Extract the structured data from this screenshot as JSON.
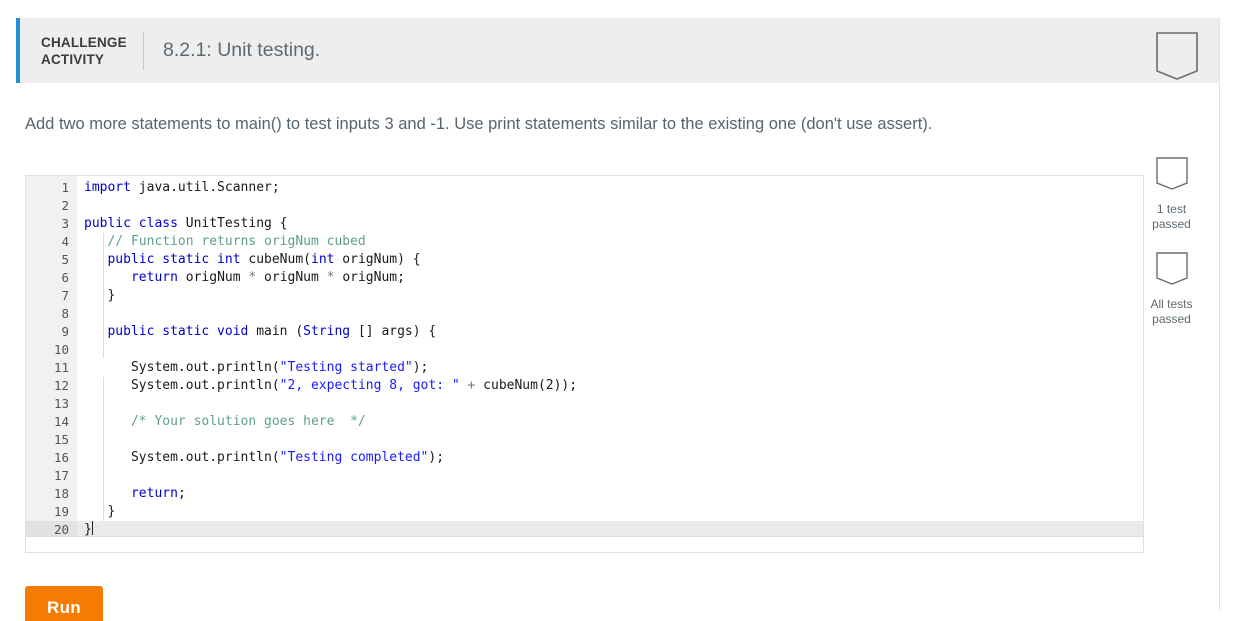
{
  "header": {
    "kicker_line1": "CHALLENGE",
    "kicker_line2": "ACTIVITY",
    "title": "8.2.1: Unit testing.",
    "bookmark_icon": "bookmark-outline-icon",
    "accent_color": "#1f8fd6",
    "background": "#eeeeee"
  },
  "prompt": {
    "text": "Add two more statements to main() to test inputs 3 and -1. Use print statements similar to the existing one (don't use assert)."
  },
  "editor": {
    "language": "java",
    "active_line": 20,
    "cursor_line": 20,
    "lines": [
      {
        "n": "1",
        "tokens": [
          {
            "t": "import",
            "c": "kw"
          },
          {
            "t": " java.util.Scanner;",
            "c": "pln"
          }
        ]
      },
      {
        "n": "2",
        "tokens": []
      },
      {
        "n": "3",
        "tokens": [
          {
            "t": "public class",
            "c": "kw"
          },
          {
            "t": " UnitTesting {",
            "c": "pln"
          }
        ]
      },
      {
        "n": "4",
        "tokens": [
          {
            "t": "   // Function returns origNum cubed",
            "c": "cmt"
          }
        ]
      },
      {
        "n": "5",
        "tokens": [
          {
            "t": "   ",
            "c": "pln"
          },
          {
            "t": "public static int",
            "c": "kw"
          },
          {
            "t": " cubeNum(",
            "c": "pln"
          },
          {
            "t": "int",
            "c": "kw"
          },
          {
            "t": " origNum) {",
            "c": "pln"
          }
        ]
      },
      {
        "n": "6",
        "tokens": [
          {
            "t": "      ",
            "c": "pln"
          },
          {
            "t": "return",
            "c": "kw"
          },
          {
            "t": " origNum ",
            "c": "pln"
          },
          {
            "t": "*",
            "c": "op"
          },
          {
            "t": " origNum ",
            "c": "pln"
          },
          {
            "t": "*",
            "c": "op"
          },
          {
            "t": " origNum;",
            "c": "pln"
          }
        ]
      },
      {
        "n": "7",
        "tokens": [
          {
            "t": "   }",
            "c": "pln"
          }
        ]
      },
      {
        "n": "8",
        "tokens": []
      },
      {
        "n": "9",
        "tokens": [
          {
            "t": "   ",
            "c": "pln"
          },
          {
            "t": "public static void",
            "c": "kw"
          },
          {
            "t": " main (",
            "c": "pln"
          },
          {
            "t": "String",
            "c": "kw"
          },
          {
            "t": " [] args) {",
            "c": "pln"
          }
        ]
      },
      {
        "n": "10",
        "tokens": []
      },
      {
        "n": "11",
        "tokens": [
          {
            "t": "      System.out.println(",
            "c": "pln"
          },
          {
            "t": "\"Testing started\"",
            "c": "str"
          },
          {
            "t": ");",
            "c": "pln"
          }
        ]
      },
      {
        "n": "12",
        "tokens": [
          {
            "t": "      System.out.println(",
            "c": "pln"
          },
          {
            "t": "\"2, expecting 8, got: \"",
            "c": "str"
          },
          {
            "t": " ",
            "c": "pln"
          },
          {
            "t": "+",
            "c": "op"
          },
          {
            "t": " cubeNum(2));",
            "c": "pln"
          }
        ]
      },
      {
        "n": "13",
        "tokens": []
      },
      {
        "n": "14",
        "tokens": [
          {
            "t": "      /* Your solution goes here  */",
            "c": "cmt"
          }
        ]
      },
      {
        "n": "15",
        "tokens": []
      },
      {
        "n": "16",
        "tokens": [
          {
            "t": "      System.out.println(",
            "c": "pln"
          },
          {
            "t": "\"Testing completed\"",
            "c": "str"
          },
          {
            "t": ");",
            "c": "pln"
          }
        ]
      },
      {
        "n": "17",
        "tokens": []
      },
      {
        "n": "18",
        "tokens": [
          {
            "t": "      ",
            "c": "pln"
          },
          {
            "t": "return",
            "c": "kw"
          },
          {
            "t": ";",
            "c": "pln"
          }
        ]
      },
      {
        "n": "19",
        "tokens": [
          {
            "t": "   }",
            "c": "pln"
          }
        ]
      },
      {
        "n": "20",
        "tokens": [
          {
            "t": "}",
            "c": "pln"
          }
        ]
      }
    ]
  },
  "run_button": {
    "label": "Run",
    "color": "#f57c00"
  },
  "rail": {
    "items": [
      {
        "icon": "shield-outline-icon",
        "label_line1": "1 test",
        "label_line2": "passed"
      },
      {
        "icon": "shield-outline-icon",
        "label_line1": "All tests",
        "label_line2": "passed"
      }
    ]
  }
}
